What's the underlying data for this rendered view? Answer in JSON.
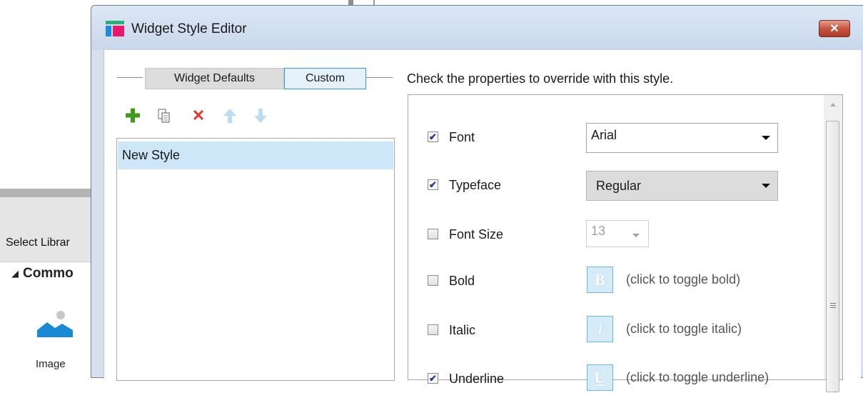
{
  "background": {
    "library_label": "Select Librar",
    "category_label": "Commo",
    "widget_label": "Image"
  },
  "dialog": {
    "title": "Widget Style Editor",
    "close_label": "✕",
    "tabs": [
      {
        "label": "Widget Defaults",
        "active": false
      },
      {
        "label": "Custom",
        "active": true
      }
    ],
    "instruction": "Check the properties to override with this style.",
    "toolbar": [
      {
        "icon": "add-icon",
        "glyph": "✚"
      },
      {
        "icon": "duplicate-icon"
      },
      {
        "icon": "delete-icon",
        "glyph": "✕"
      },
      {
        "icon": "move-up-icon"
      },
      {
        "icon": "move-down-icon"
      }
    ],
    "styles": [
      "New Style"
    ],
    "properties": {
      "font": {
        "label": "Font",
        "checked": true,
        "value": "Arial"
      },
      "typeface": {
        "label": "Typeface",
        "checked": true,
        "value": "Regular"
      },
      "font_size": {
        "label": "Font Size",
        "checked": false,
        "value": "13"
      },
      "bold": {
        "label": "Bold",
        "checked": false,
        "button": "B",
        "hint": "(click to toggle bold)"
      },
      "italic": {
        "label": "Italic",
        "checked": false,
        "button": "I",
        "hint": "(click to toggle italic)"
      },
      "underline": {
        "label": "Underline",
        "checked": true,
        "button": "U",
        "hint": "(click to toggle underline)"
      }
    },
    "check_glyph": "✔"
  },
  "colors": {
    "selection": "#cde6f8",
    "accent": "#3d9ad8",
    "add": "#3d9a1c",
    "delete": "#e23a2d"
  }
}
